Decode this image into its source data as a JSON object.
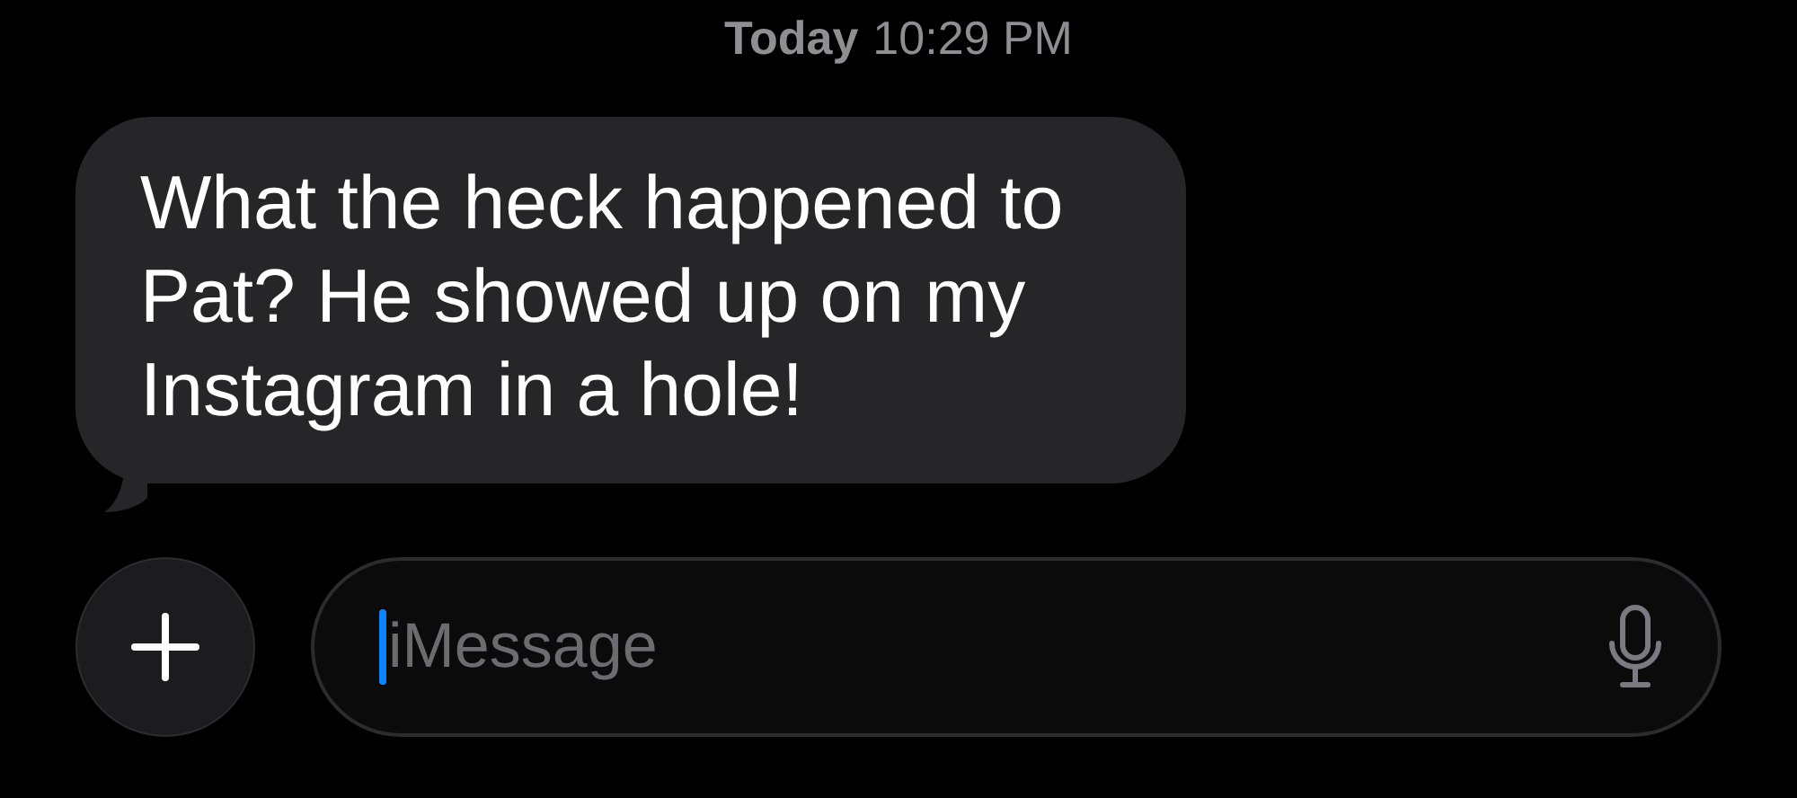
{
  "timestamp": {
    "day": "Today",
    "time": "10:29 PM"
  },
  "messages": [
    {
      "text": "What the heck happened to Pat? He showed up on my Instagram in a hole!"
    }
  ],
  "composer": {
    "placeholder": "iMessage"
  }
}
